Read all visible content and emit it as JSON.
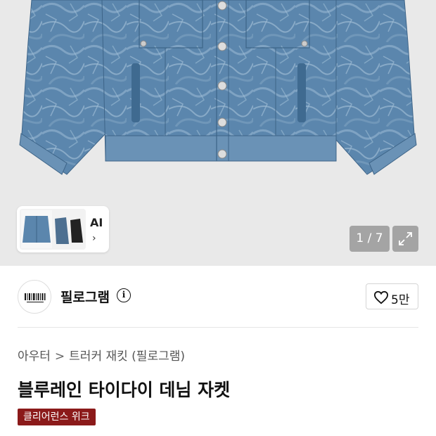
{
  "gallery": {
    "ai_label": "AI",
    "ai_arrow": "›",
    "counter": "1 / 7"
  },
  "brand": {
    "name": "필로그램",
    "info_glyph": "i",
    "like_count": "5만"
  },
  "breadcrumb": {
    "category": "아우터",
    "separator": ">",
    "subcategory": "트러커 재킷 (필로그램)"
  },
  "product": {
    "title": "블루레인 타이다이 데님 자켓",
    "badge": "클리어런스 위크"
  },
  "colors": {
    "denim": "#5b86ad",
    "badge": "#8b1a1a",
    "background": "#e9e9e9"
  }
}
